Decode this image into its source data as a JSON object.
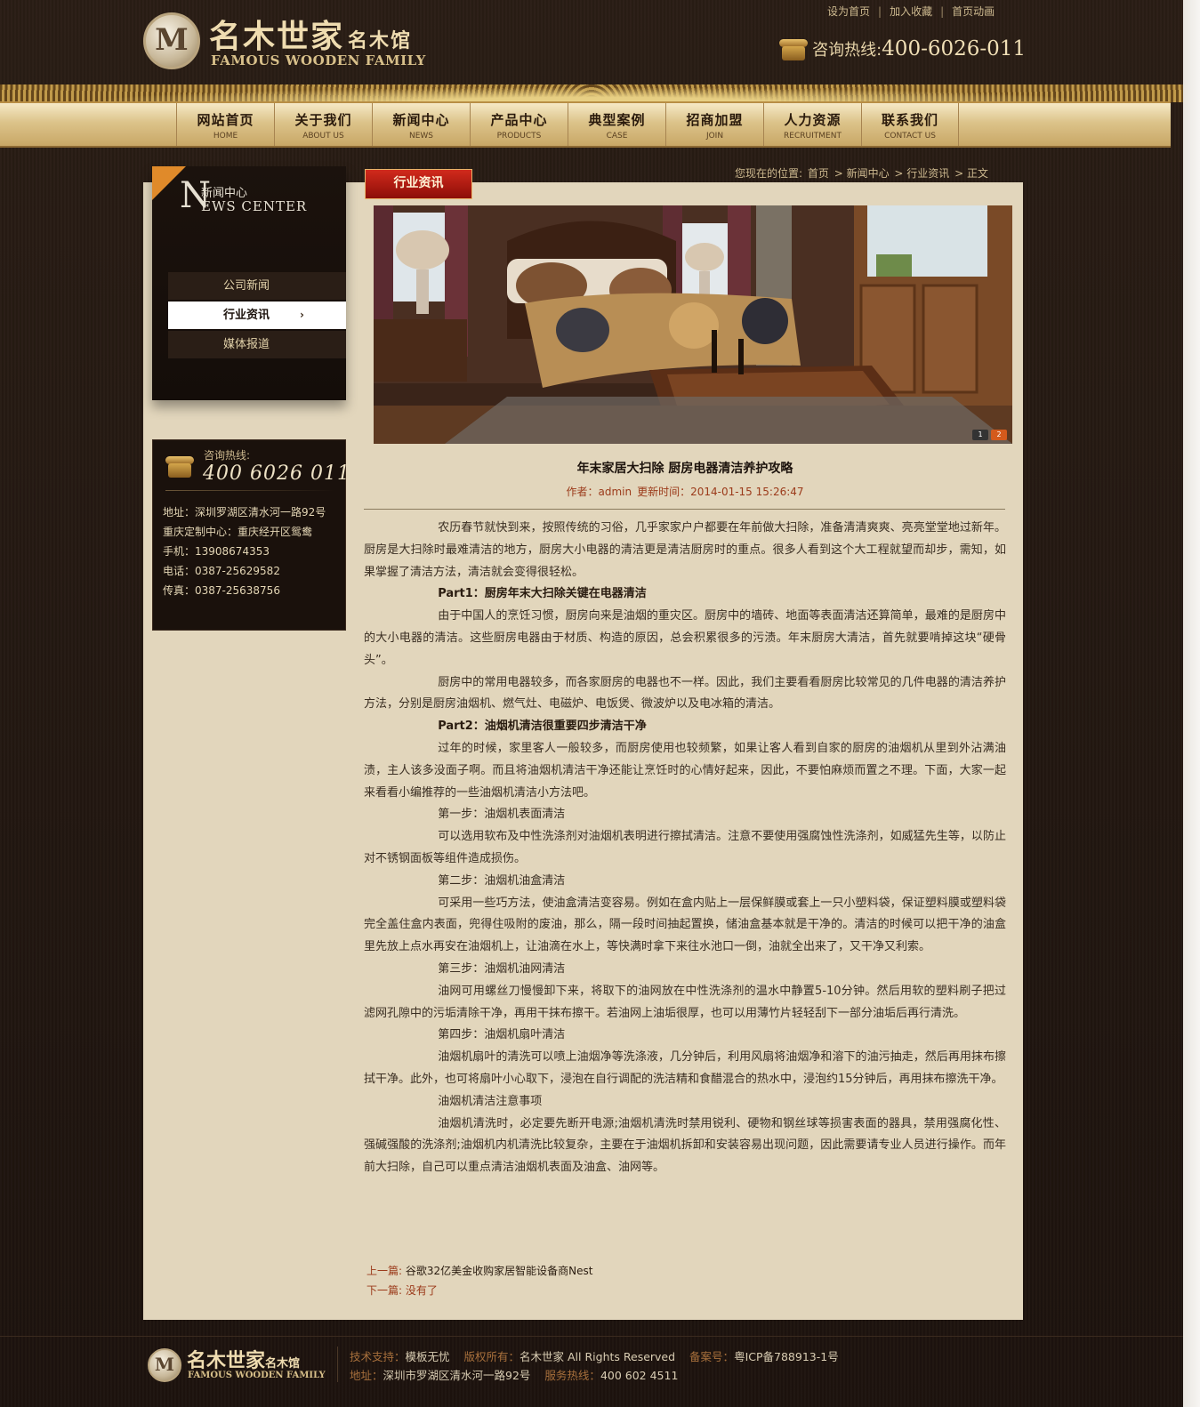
{
  "header": {
    "logo_badge": "M",
    "logo_cn": "名木世家",
    "logo_cn_small": "名木馆",
    "logo_en": "FAMOUS WOODEN FAMILY",
    "toplinks": [
      "设为首页",
      "加入收藏",
      "首页动画"
    ],
    "hotline_label": "咨询热线:",
    "hotline_number": "400-6026-011"
  },
  "nav": [
    {
      "cn": "网站首页",
      "en": "HOME"
    },
    {
      "cn": "关于我们",
      "en": "ABOUT US"
    },
    {
      "cn": "新闻中心",
      "en": "NEWS"
    },
    {
      "cn": "产品中心",
      "en": "PRODUCTS"
    },
    {
      "cn": "典型案例",
      "en": "CASE"
    },
    {
      "cn": "招商加盟",
      "en": "JOIN"
    },
    {
      "cn": "人力资源",
      "en": "RECRUITMENT"
    },
    {
      "cn": "联系我们",
      "en": "CONTACT US"
    }
  ],
  "sidebar": {
    "news_big_letter": "N",
    "news_cn": "新闻中心",
    "news_en": "EWS CENTER",
    "menu": [
      "公司新闻",
      "行业资讯",
      "媒体报道"
    ],
    "active_index": 1,
    "arrow": "›",
    "contact": {
      "label": "咨询热线:",
      "number": "400 6026 011",
      "lines": [
        "地址：深圳罗湖区清水河一路92号",
        "重庆定制中心：重庆经开区鸳鸯",
        "手机：13908674353",
        "电话：0387-25629582",
        "传真：0387-25638756"
      ]
    }
  },
  "section_tab": "行业资讯",
  "breadcrumb": {
    "label": "您现在的位置:",
    "items": [
      "首页",
      "> 新闻中心",
      "> 行业资讯",
      "> 正文"
    ]
  },
  "slider": {
    "dots": [
      "1",
      "2"
    ],
    "active": 1
  },
  "article": {
    "title": "年末家居大扫除  厨房电器清洁养护攻略",
    "meta_author": "作者：admin",
    "meta_time": "更新时间：2014-01-15 15:26:47",
    "paragraphs": [
      {
        "text": "农历春节就快到来，按照传统的习俗，几乎家家户户都要在年前做大扫除，准备清清爽爽、亮亮堂堂地过新年。厨房是大扫除时最难清洁的地方，厨房大小电器的清洁更是清洁厨房时的重点。很多人看到这个大工程就望而却步，需知，如果掌握了清洁方法，清洁就会变得很轻松。",
        "sub": false
      },
      {
        "text": "Part1：厨房年末大扫除关键在电器清洁",
        "sub": true
      },
      {
        "text": "由于中国人的烹饪习惯，厨房向来是油烟的重灾区。厨房中的墙砖、地面等表面清洁还算简单，最难的是厨房中的大小电器的清洁。这些厨房电器由于材质、构造的原因，总会积累很多的污渍。年末厨房大清洁，首先就要啃掉这块“硬骨头”。",
        "sub": false
      },
      {
        "text": "厨房中的常用电器较多，而各家厨房的电器也不一样。因此，我们主要看看厨房比较常见的几件电器的清洁养护方法，分别是厨房油烟机、燃气灶、电磁炉、电饭煲、微波炉以及电冰箱的清洁。",
        "sub": false
      },
      {
        "text": "Part2：油烟机清洁很重要四步清洁干净",
        "sub": true
      },
      {
        "text": "过年的时候，家里客人一般较多，而厨房使用也较频繁，如果让客人看到自家的厨房的油烟机从里到外沾满油渍，主人该多没面子啊。而且将油烟机清洁干净还能让烹饪时的心情好起来，因此，不要怕麻烦而置之不理。下面，大家一起来看看小编推荐的一些油烟机清洁小方法吧。",
        "sub": false
      },
      {
        "text": "第一步：油烟机表面清洁",
        "sub": false
      },
      {
        "text": "可以选用软布及中性洗涤剂对油烟机表明进行擦拭清洁。注意不要使用强腐蚀性洗涤剂，如威猛先生等，以防止对不锈钢面板等组件造成损伤。",
        "sub": false
      },
      {
        "text": "第二步：油烟机油盒清洁",
        "sub": false
      },
      {
        "text": "可采用一些巧方法，使油盒清洁变容易。例如在盒内贴上一层保鲜膜或套上一只小塑料袋，保证塑料膜或塑料袋完全盖住盒内表面，兜得住吸附的废油，那么，隔一段时间抽起置换，储油盒基本就是干净的。清洁的时候可以把干净的油盒里先放上点水再安在油烟机上，让油滴在水上，等快满时拿下来往水池口一倒，油就全出来了，又干净又利索。",
        "sub": false
      },
      {
        "text": "第三步：油烟机油网清洁",
        "sub": false
      },
      {
        "text": "油网可用螺丝刀慢慢卸下来，将取下的油网放在中性洗涤剂的温水中静置5-10分钟。然后用软的塑料刷子把过滤网孔隙中的污垢清除干净，再用干抹布擦干。若油网上油垢很厚，也可以用薄竹片轻轻刮下一部分油垢后再行清洗。",
        "sub": false
      },
      {
        "text": "第四步：油烟机扇叶清洁",
        "sub": false
      },
      {
        "text": "油烟机扇叶的清洗可以喷上油烟净等洗涤液，几分钟后，利用风扇将油烟净和溶下的油污抽走，然后再用抹布擦拭干净。此外，也可将扇叶小心取下，浸泡在自行调配的洗洁精和食醋混合的热水中，浸泡约15分钟后，再用抹布擦洗干净。",
        "sub": false
      },
      {
        "text": "油烟机清洁注意事项",
        "sub": false
      },
      {
        "text": "油烟机清洗时，必定要先断开电源;油烟机清洗时禁用锐利、硬物和钢丝球等损害表面的器具，禁用强腐化性、强碱强酸的洗涤剂;油烟机内机清洗比较复杂，主要在于油烟机拆卸和安装容易出现问题，因此需要请专业人员进行操作。而年前大扫除，自己可以重点清洁油烟机表面及油盒、油网等。",
        "sub": false
      }
    ],
    "prev_label": "上一篇:",
    "prev_title": "谷歌32亿美金收购家居智能设备商Nest",
    "next_label": "下一篇:",
    "next_title": "没有了"
  },
  "footer": {
    "logo_badge": "M",
    "logo_cn": "名木世家",
    "logo_cn_small": "名木馆",
    "logo_en": "FAMOUS WOODEN FAMILY",
    "tech_label": "技术支持：",
    "tech_value": "模板无忧",
    "copyright_label": "版权所有：",
    "copyright_value": "名木世家  All Rights Reserved",
    "icp_label": "备案号：",
    "icp_value": "粤ICP备788913-1号",
    "address_label": "地址：",
    "address_value": "深圳市罗湖区清水河一路92号",
    "service_label": "服务热线：",
    "service_value": "400 602 4511"
  },
  "colors": {
    "background": "#1f1510",
    "content_panel": "#e2d6bc",
    "accent_red": "#b1180f",
    "gold": "#d8c08a"
  }
}
